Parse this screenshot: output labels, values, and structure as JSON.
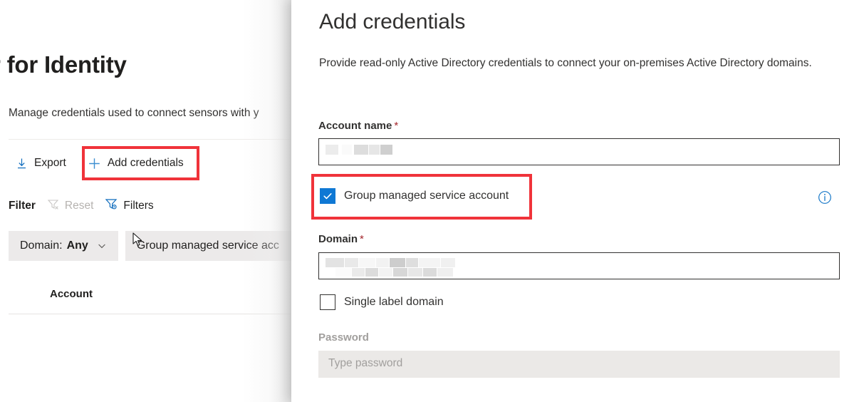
{
  "background_page": {
    "title": "r for Identity",
    "subtitle": "Manage credentials used to connect sensors with y",
    "commands": [
      {
        "label": "Export",
        "icon": "download-icon"
      },
      {
        "label": "Add credentials",
        "icon": "plus-icon"
      }
    ],
    "filter_bar": {
      "label": "Filter",
      "reset_label": "Reset",
      "reset_icon": "filter-clear-icon",
      "filters_label": "Filters",
      "filters_icon": "filter-settings-icon"
    },
    "filter_pills": [
      {
        "key": "Domain:",
        "value": "Any",
        "icon": "chevron-down-icon"
      },
      {
        "key": "",
        "value": "Group managed service acc",
        "icon": ""
      }
    ],
    "table": {
      "columns": [
        "Account"
      ],
      "rows": []
    }
  },
  "panel": {
    "title": "Add credentials",
    "description": "Provide read-only Active Directory credentials to connect your on-premises Active Directory domains.",
    "fields": {
      "account_name": {
        "label": "Account name",
        "required_marker": "*",
        "value": "",
        "placeholder": ""
      },
      "gmsa_checkbox": {
        "label": "Group managed service account",
        "checked": "true",
        "info_icon": "info-circle-icon"
      },
      "domain": {
        "label": "Domain",
        "required_marker": "*",
        "value": "",
        "placeholder": ""
      },
      "single_label_domain": {
        "label": "Single label domain",
        "checked": "false"
      },
      "password": {
        "label": "Password",
        "placeholder": "Type password",
        "disabled": "true"
      }
    }
  },
  "annotations": {
    "highlight_color": "#f0333a",
    "boxes": [
      {
        "target": "Add credentials"
      },
      {
        "target": "Group managed service account"
      }
    ]
  },
  "theme": {
    "accent": "#0f78d4",
    "required_red": "#a4262c",
    "text": "#323130",
    "pill_bg": "#eceaea"
  }
}
